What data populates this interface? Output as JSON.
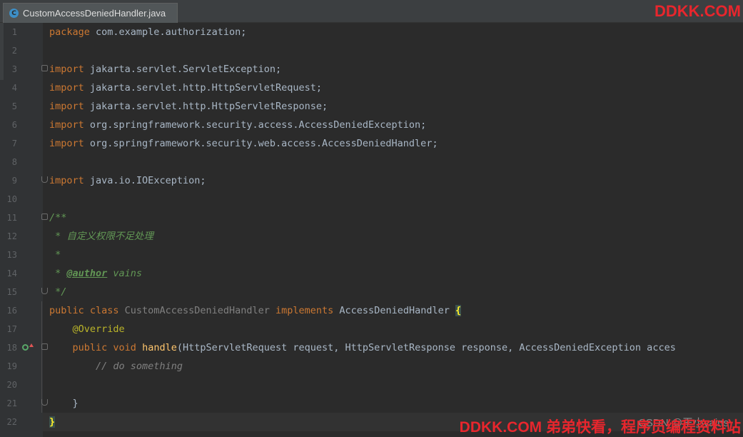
{
  "tab": {
    "label": "CustomAccessDeniedHandler.java",
    "icon": "class-c-icon"
  },
  "watermark_top": "DDKK.COM",
  "watermark_bottom": "DDKK.COM 弟弟快看，程序员编程资料站",
  "csdn_mark": "CSDN @王小vains",
  "line_numbers": [
    "1",
    "2",
    "3",
    "4",
    "5",
    "6",
    "7",
    "8",
    "9",
    "10",
    "11",
    "12",
    "13",
    "14",
    "15",
    "16",
    "17",
    "18",
    "19",
    "20",
    "21",
    "22"
  ],
  "code": {
    "l1": {
      "kw": "package",
      "rest": " com.example.authorization;"
    },
    "l3": {
      "kw": "import",
      "rest": " jakarta.servlet.ServletException;"
    },
    "l4": {
      "kw": "import",
      "rest": " jakarta.servlet.http.HttpServletRequest;"
    },
    "l5": {
      "kw": "import",
      "rest": " jakarta.servlet.http.HttpServletResponse;"
    },
    "l6": {
      "kw": "import",
      "rest": " org.springframework.security.access.AccessDeniedException;"
    },
    "l7": {
      "kw": "import",
      "rest": " org.springframework.security.web.access.AccessDeniedHandler;"
    },
    "l9": {
      "kw": "import",
      "rest": " java.io.IOException;"
    },
    "l11": "/**",
    "l12": " * 自定义权限不足处理",
    "l13": " *",
    "l14_prefix": " * ",
    "l14_tag": "@author",
    "l14_rest": " vains",
    "l15": " */",
    "l16": {
      "kw1": "public class ",
      "cls": "CustomAccessDeniedHandler",
      "kw2": " implements ",
      "iface": "AccessDeniedHandler",
      "brace": "{"
    },
    "l17": "@Override",
    "l18": {
      "kw": "public void ",
      "fn": "handle",
      "rest": "(HttpServletRequest request, HttpServletResponse response, AccessDeniedException acces"
    },
    "l19": "// do something",
    "l21": "}",
    "l22": "}"
  }
}
